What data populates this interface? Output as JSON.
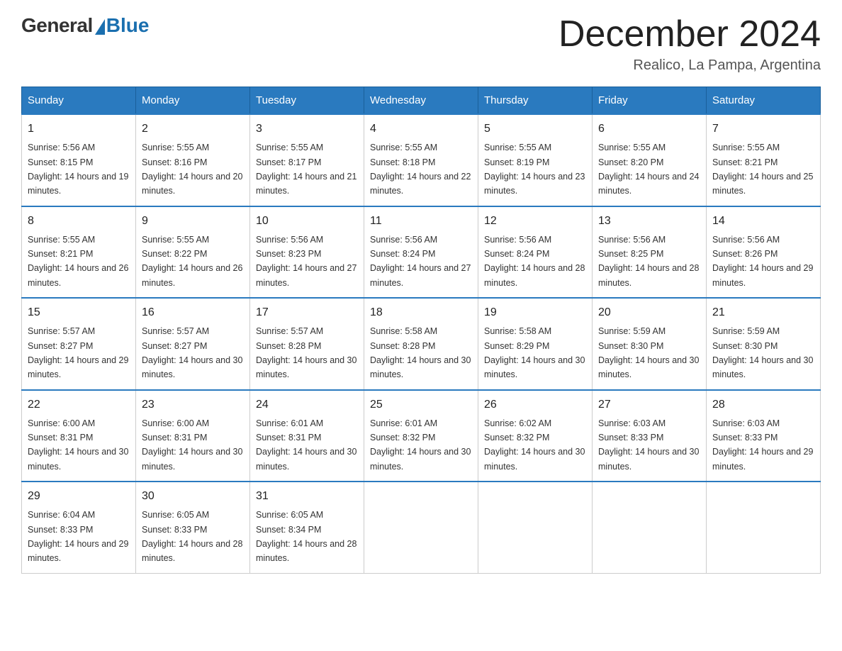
{
  "logo": {
    "general": "General",
    "blue": "Blue",
    "subtitle": ""
  },
  "title": "December 2024",
  "subtitle": "Realico, La Pampa, Argentina",
  "headers": [
    "Sunday",
    "Monday",
    "Tuesday",
    "Wednesday",
    "Thursday",
    "Friday",
    "Saturday"
  ],
  "weeks": [
    [
      {
        "num": "1",
        "sunrise": "5:56 AM",
        "sunset": "8:15 PM",
        "daylight": "14 hours and 19 minutes."
      },
      {
        "num": "2",
        "sunrise": "5:55 AM",
        "sunset": "8:16 PM",
        "daylight": "14 hours and 20 minutes."
      },
      {
        "num": "3",
        "sunrise": "5:55 AM",
        "sunset": "8:17 PM",
        "daylight": "14 hours and 21 minutes."
      },
      {
        "num": "4",
        "sunrise": "5:55 AM",
        "sunset": "8:18 PM",
        "daylight": "14 hours and 22 minutes."
      },
      {
        "num": "5",
        "sunrise": "5:55 AM",
        "sunset": "8:19 PM",
        "daylight": "14 hours and 23 minutes."
      },
      {
        "num": "6",
        "sunrise": "5:55 AM",
        "sunset": "8:20 PM",
        "daylight": "14 hours and 24 minutes."
      },
      {
        "num": "7",
        "sunrise": "5:55 AM",
        "sunset": "8:21 PM",
        "daylight": "14 hours and 25 minutes."
      }
    ],
    [
      {
        "num": "8",
        "sunrise": "5:55 AM",
        "sunset": "8:21 PM",
        "daylight": "14 hours and 26 minutes."
      },
      {
        "num": "9",
        "sunrise": "5:55 AM",
        "sunset": "8:22 PM",
        "daylight": "14 hours and 26 minutes."
      },
      {
        "num": "10",
        "sunrise": "5:56 AM",
        "sunset": "8:23 PM",
        "daylight": "14 hours and 27 minutes."
      },
      {
        "num": "11",
        "sunrise": "5:56 AM",
        "sunset": "8:24 PM",
        "daylight": "14 hours and 27 minutes."
      },
      {
        "num": "12",
        "sunrise": "5:56 AM",
        "sunset": "8:24 PM",
        "daylight": "14 hours and 28 minutes."
      },
      {
        "num": "13",
        "sunrise": "5:56 AM",
        "sunset": "8:25 PM",
        "daylight": "14 hours and 28 minutes."
      },
      {
        "num": "14",
        "sunrise": "5:56 AM",
        "sunset": "8:26 PM",
        "daylight": "14 hours and 29 minutes."
      }
    ],
    [
      {
        "num": "15",
        "sunrise": "5:57 AM",
        "sunset": "8:27 PM",
        "daylight": "14 hours and 29 minutes."
      },
      {
        "num": "16",
        "sunrise": "5:57 AM",
        "sunset": "8:27 PM",
        "daylight": "14 hours and 30 minutes."
      },
      {
        "num": "17",
        "sunrise": "5:57 AM",
        "sunset": "8:28 PM",
        "daylight": "14 hours and 30 minutes."
      },
      {
        "num": "18",
        "sunrise": "5:58 AM",
        "sunset": "8:28 PM",
        "daylight": "14 hours and 30 minutes."
      },
      {
        "num": "19",
        "sunrise": "5:58 AM",
        "sunset": "8:29 PM",
        "daylight": "14 hours and 30 minutes."
      },
      {
        "num": "20",
        "sunrise": "5:59 AM",
        "sunset": "8:30 PM",
        "daylight": "14 hours and 30 minutes."
      },
      {
        "num": "21",
        "sunrise": "5:59 AM",
        "sunset": "8:30 PM",
        "daylight": "14 hours and 30 minutes."
      }
    ],
    [
      {
        "num": "22",
        "sunrise": "6:00 AM",
        "sunset": "8:31 PM",
        "daylight": "14 hours and 30 minutes."
      },
      {
        "num": "23",
        "sunrise": "6:00 AM",
        "sunset": "8:31 PM",
        "daylight": "14 hours and 30 minutes."
      },
      {
        "num": "24",
        "sunrise": "6:01 AM",
        "sunset": "8:31 PM",
        "daylight": "14 hours and 30 minutes."
      },
      {
        "num": "25",
        "sunrise": "6:01 AM",
        "sunset": "8:32 PM",
        "daylight": "14 hours and 30 minutes."
      },
      {
        "num": "26",
        "sunrise": "6:02 AM",
        "sunset": "8:32 PM",
        "daylight": "14 hours and 30 minutes."
      },
      {
        "num": "27",
        "sunrise": "6:03 AM",
        "sunset": "8:33 PM",
        "daylight": "14 hours and 30 minutes."
      },
      {
        "num": "28",
        "sunrise": "6:03 AM",
        "sunset": "8:33 PM",
        "daylight": "14 hours and 29 minutes."
      }
    ],
    [
      {
        "num": "29",
        "sunrise": "6:04 AM",
        "sunset": "8:33 PM",
        "daylight": "14 hours and 29 minutes."
      },
      {
        "num": "30",
        "sunrise": "6:05 AM",
        "sunset": "8:33 PM",
        "daylight": "14 hours and 28 minutes."
      },
      {
        "num": "31",
        "sunrise": "6:05 AM",
        "sunset": "8:34 PM",
        "daylight": "14 hours and 28 minutes."
      },
      null,
      null,
      null,
      null
    ]
  ]
}
